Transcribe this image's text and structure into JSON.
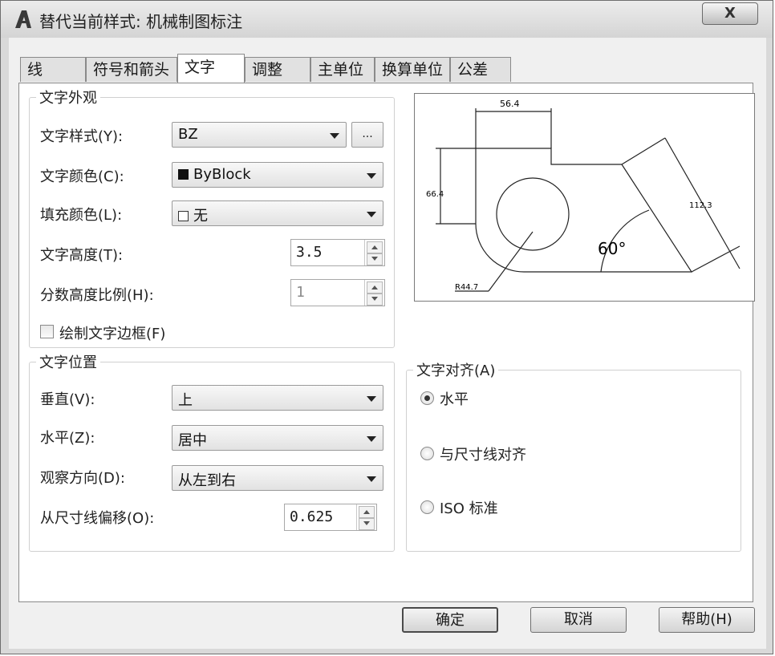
{
  "window": {
    "title": "替代当前样式: 机械制图标注",
    "close_label": "X"
  },
  "tabs": [
    {
      "label": "线"
    },
    {
      "label": "符号和箭头"
    },
    {
      "label": "文字"
    },
    {
      "label": "调整"
    },
    {
      "label": "主单位"
    },
    {
      "label": "换算单位"
    },
    {
      "label": "公差"
    }
  ],
  "active_tab": "文字",
  "text_appearance": {
    "legend": "文字外观",
    "style_label": "文字样式(Y):",
    "style_value": "BZ",
    "style_button": "...",
    "color_label": "文字颜色(C):",
    "color_value": "ByBlock",
    "fill_label": "填充颜色(L):",
    "fill_value": "无",
    "height_label": "文字高度(T):",
    "height_value": "3.5",
    "fraction_label": "分数高度比例(H):",
    "fraction_value": "1",
    "frame_label": "绘制文字边框(F)",
    "frame_checked": false
  },
  "preview": {
    "dim_top": "56.4",
    "dim_left": "66.4",
    "dim_slant": "112.3",
    "angle": "60°",
    "radius": "R44.7"
  },
  "text_placement": {
    "legend": "文字位置",
    "vertical_label": "垂直(V):",
    "vertical_value": "上",
    "horizontal_label": "水平(Z):",
    "horizontal_value": "居中",
    "direction_label": "观察方向(D):",
    "direction_value": "从左到右",
    "offset_label": "从尺寸线偏移(O):",
    "offset_value": "0.625"
  },
  "text_alignment": {
    "legend": "文字对齐(A)",
    "options": [
      {
        "label": "水平",
        "selected": true
      },
      {
        "label": "与尺寸线对齐",
        "selected": false
      },
      {
        "label": "ISO 标准",
        "selected": false
      }
    ]
  },
  "buttons": {
    "ok": "确定",
    "cancel": "取消",
    "help": "帮助(H)"
  }
}
